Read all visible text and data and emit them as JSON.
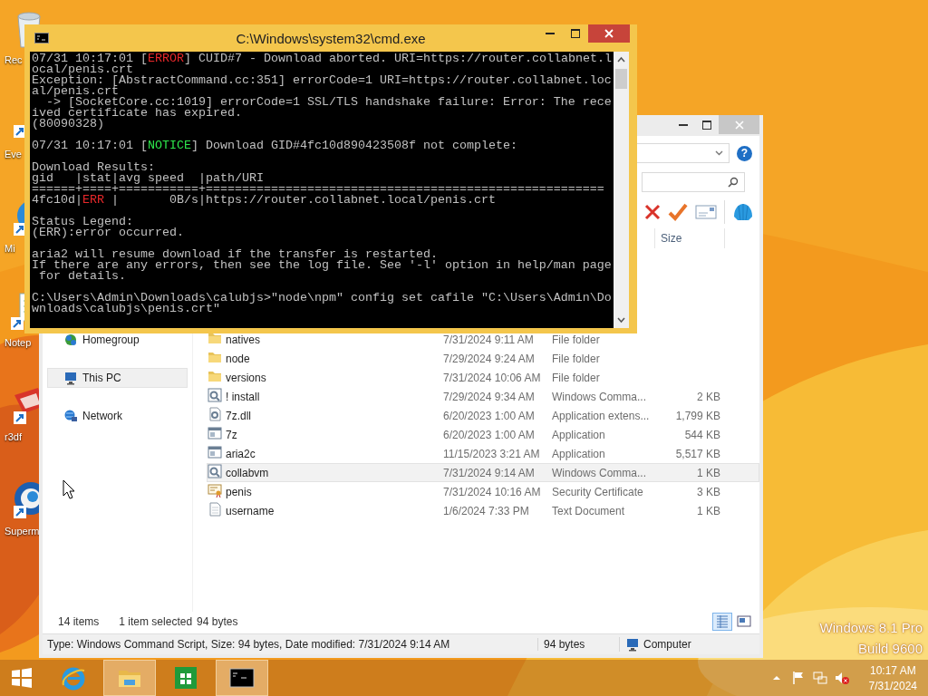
{
  "desktop": {
    "icons": [
      {
        "kind": "recycle",
        "label": "Rec"
      },
      {
        "kind": "shortcut",
        "label": "Eve"
      },
      {
        "kind": "circle",
        "label": "Mi"
      },
      {
        "kind": "notepad",
        "label": "Notep"
      },
      {
        "kind": "red-app",
        "label": "r3df"
      },
      {
        "kind": "globe",
        "label": "Superm"
      }
    ],
    "edition": [
      "Windows 8.1 Pro",
      "Build 9600"
    ]
  },
  "explorer": {
    "help": "?",
    "columns": [
      {
        "label": "Size"
      }
    ],
    "nav": [
      {
        "label": "Homegroup",
        "kind": "homegroup",
        "selected": false
      },
      {
        "label": "This PC",
        "kind": "pc",
        "selected": true
      },
      {
        "label": "Network",
        "kind": "network",
        "selected": false
      }
    ],
    "rows": [
      {
        "kind": "folder",
        "name": "natives",
        "date": "7/31/2024 9:11 AM",
        "type": "File folder",
        "selected": false
      },
      {
        "kind": "folder",
        "name": "node",
        "date": "7/29/2024 9:24 AM",
        "type": "File folder",
        "selected": false
      },
      {
        "kind": "folder",
        "name": "versions",
        "date": "7/31/2024 10:06 AM",
        "type": "File folder",
        "selected": false
      },
      {
        "kind": "script",
        "name": "! install",
        "date": "7/29/2024 9:34 AM",
        "type": "Windows Comma...",
        "size": "2 KB",
        "selected": false
      },
      {
        "kind": "dll",
        "name": "7z.dll",
        "date": "6/20/2023 1:00 AM",
        "type": "Application extens...",
        "size": "1,799 KB",
        "selected": false
      },
      {
        "kind": "app",
        "name": "7z",
        "date": "6/20/2023 1:00 AM",
        "type": "Application",
        "size": "544 KB",
        "selected": false
      },
      {
        "kind": "app",
        "name": "aria2c",
        "date": "11/15/2023 3:21 AM",
        "type": "Application",
        "size": "5,517 KB",
        "selected": false
      },
      {
        "kind": "script",
        "name": "collabvm",
        "date": "7/31/2024 9:14 AM",
        "type": "Windows Comma...",
        "size": "1 KB",
        "selected": true
      },
      {
        "kind": "cert",
        "name": "penis",
        "date": "7/31/2024 10:16 AM",
        "type": "Security Certificate",
        "size": "3 KB",
        "selected": false
      },
      {
        "kind": "text",
        "name": "username",
        "date": "1/6/2024 7:33 PM",
        "type": "Text Document",
        "size": "1 KB",
        "selected": false
      }
    ],
    "footer": {
      "count": "14 items",
      "selection": "1 item selected",
      "selection_size": "94 bytes"
    },
    "views": [
      {
        "kind": "details",
        "selected": true
      },
      {
        "kind": "tiles",
        "selected": false
      }
    ],
    "status_bar": {
      "info": "Type: Windows Command Script, Size: 94 bytes, Date modified: 7/31/2024 9:14 AM",
      "size": "94 bytes",
      "location": "Computer"
    }
  },
  "console": {
    "title": "C:\\Windows\\system32\\cmd.exe",
    "blocks": [
      [
        [
          {
            "kind": "plain",
            "text": "07/31 10:17:01 ["
          },
          {
            "kind": "error",
            "text": "ERROR"
          },
          {
            "kind": "plain",
            "text": "] CUID#7 - Download aborted. URI=https://router.collabnet.l"
          }
        ],
        [
          {
            "kind": "plain",
            "text": "ocal/penis.crt"
          }
        ],
        [
          {
            "kind": "plain",
            "text": "Exception: [AbstractCommand.cc:351] errorCode=1 URI=https://router.collabnet.loc"
          }
        ],
        [
          {
            "kind": "plain",
            "text": "al/penis.crt"
          }
        ],
        [
          {
            "kind": "plain",
            "text": "  -> [SocketCore.cc:1019] errorCode=1 SSL/TLS handshake failure: Error: The rece"
          }
        ],
        [
          {
            "kind": "plain",
            "text": "ived certificate has expired."
          }
        ],
        [
          {
            "kind": "plain",
            "text": "(80090328)"
          }
        ]
      ],
      [
        [
          {
            "kind": "plain",
            "text": "07/31 10:17:01 ["
          },
          {
            "kind": "notice",
            "text": "NOTICE"
          },
          {
            "kind": "plain",
            "text": "] Download GID#4fc10d890423508f not complete:"
          }
        ]
      ],
      [
        [
          {
            "kind": "plain",
            "text": "Download Results:"
          }
        ],
        [
          {
            "kind": "plain",
            "text": "gid   |stat|avg speed  |path/URI"
          }
        ],
        [
          {
            "kind": "plain",
            "text": "======+====+===========+======================================================="
          }
        ],
        [
          {
            "kind": "plain",
            "text": "4fc10d|"
          },
          {
            "kind": "error",
            "text": "ERR"
          },
          {
            "kind": "plain",
            "text": " |       0B/s|https://router.collabnet.local/penis.crt"
          }
        ]
      ],
      [
        [
          {
            "kind": "plain",
            "text": "Status Legend:"
          }
        ],
        [
          {
            "kind": "plain",
            "text": "(ERR):error occurred."
          }
        ]
      ],
      [
        [
          {
            "kind": "plain",
            "text": "aria2 will resume download if the transfer is restarted."
          }
        ],
        [
          {
            "kind": "plain",
            "text": "If there are any errors, then see the log file. See '-l' option in help/man page"
          }
        ],
        [
          {
            "kind": "plain",
            "text": " for details."
          }
        ]
      ],
      [
        [
          {
            "kind": "plain",
            "text": "C:\\Users\\Admin\\Downloads\\calubjs>\"node\\npm\" config set cafile \"C:\\Users\\Admin\\Do"
          }
        ],
        [
          {
            "kind": "plain",
            "text": "wnloads\\calubjs\\penis.crt\""
          }
        ]
      ]
    ]
  },
  "taskbar": {
    "apps": [
      {
        "kind": "ie",
        "open": false
      },
      {
        "kind": "explorer",
        "open": true
      },
      {
        "kind": "store",
        "open": false
      },
      {
        "kind": "cmd",
        "open": true
      }
    ],
    "tray": [
      {
        "kind": "caret"
      },
      {
        "kind": "flag"
      },
      {
        "kind": "network"
      },
      {
        "kind": "volume",
        "muted": true
      }
    ],
    "time": "10:17 AM",
    "date": "7/31/2024"
  }
}
